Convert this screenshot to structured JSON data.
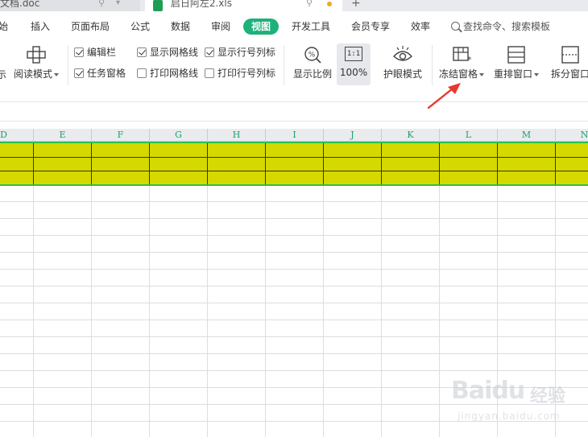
{
  "tabs": [
    {
      "label": "文档.doc"
    },
    {
      "label": "启日阿左2.xls"
    }
  ],
  "menu": {
    "items": [
      "始",
      "插入",
      "页面布局",
      "公式",
      "数据",
      "审阅",
      "视图",
      "开发工具",
      "会员专享",
      "效率"
    ],
    "active": "视图",
    "search_placeholder": "查找命令、搜索模板"
  },
  "ribbon": {
    "left_cut": "示",
    "reading_mode": "阅读模式",
    "checkboxes": [
      {
        "label": "编辑栏",
        "checked": true
      },
      {
        "label": "任务窗格",
        "checked": true
      },
      {
        "label": "显示网格线",
        "checked": true
      },
      {
        "label": "打印网格线",
        "checked": false
      },
      {
        "label": "显示行号列标",
        "checked": true
      },
      {
        "label": "打印行号列标",
        "checked": false
      }
    ],
    "zoom_ratio": "显示比例",
    "one_to_one": "1:1",
    "zoom_value": "100%",
    "eye_mode": "护眼模式",
    "freeze_panes": "冻结窗格",
    "arrange_window": "重排窗口",
    "split_window": "拆分窗口"
  },
  "columns": [
    "D",
    "E",
    "F",
    "G",
    "H",
    "I",
    "J",
    "K",
    "L",
    "M",
    "N"
  ],
  "highlight": {
    "fill_color": "#d6d900",
    "border_color": "#2cc04a",
    "row_count": 3
  },
  "accent_color": "#1eb17a",
  "arrow_color": "#e8382f",
  "watermark": {
    "logo": "Baidu",
    "cn": "经验",
    "url": "jingyan.baidu.com"
  }
}
